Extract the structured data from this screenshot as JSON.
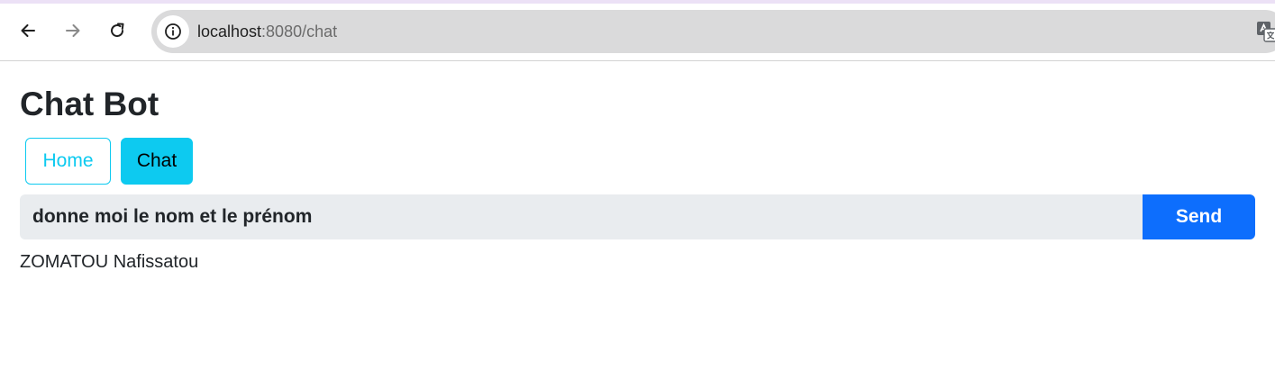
{
  "browser": {
    "url_host": "localhost",
    "url_rest": ":8080/chat",
    "icons": {
      "back": "arrow-left-icon",
      "forward": "arrow-right-icon",
      "reload": "reload-icon",
      "site_info": "info-icon",
      "translate": "translate-icon"
    }
  },
  "page": {
    "title": "Chat Bot"
  },
  "nav": {
    "home_label": "Home",
    "chat_label": "Chat"
  },
  "chat": {
    "query_value": "donne moi le nom et le prénom",
    "send_label": "Send",
    "response": "ZOMATOU Nafissatou"
  },
  "colors": {
    "info_accent": "#0dcaf0",
    "primary": "#0d6efd",
    "input_background": "#e9ecef",
    "text": "#212529"
  }
}
